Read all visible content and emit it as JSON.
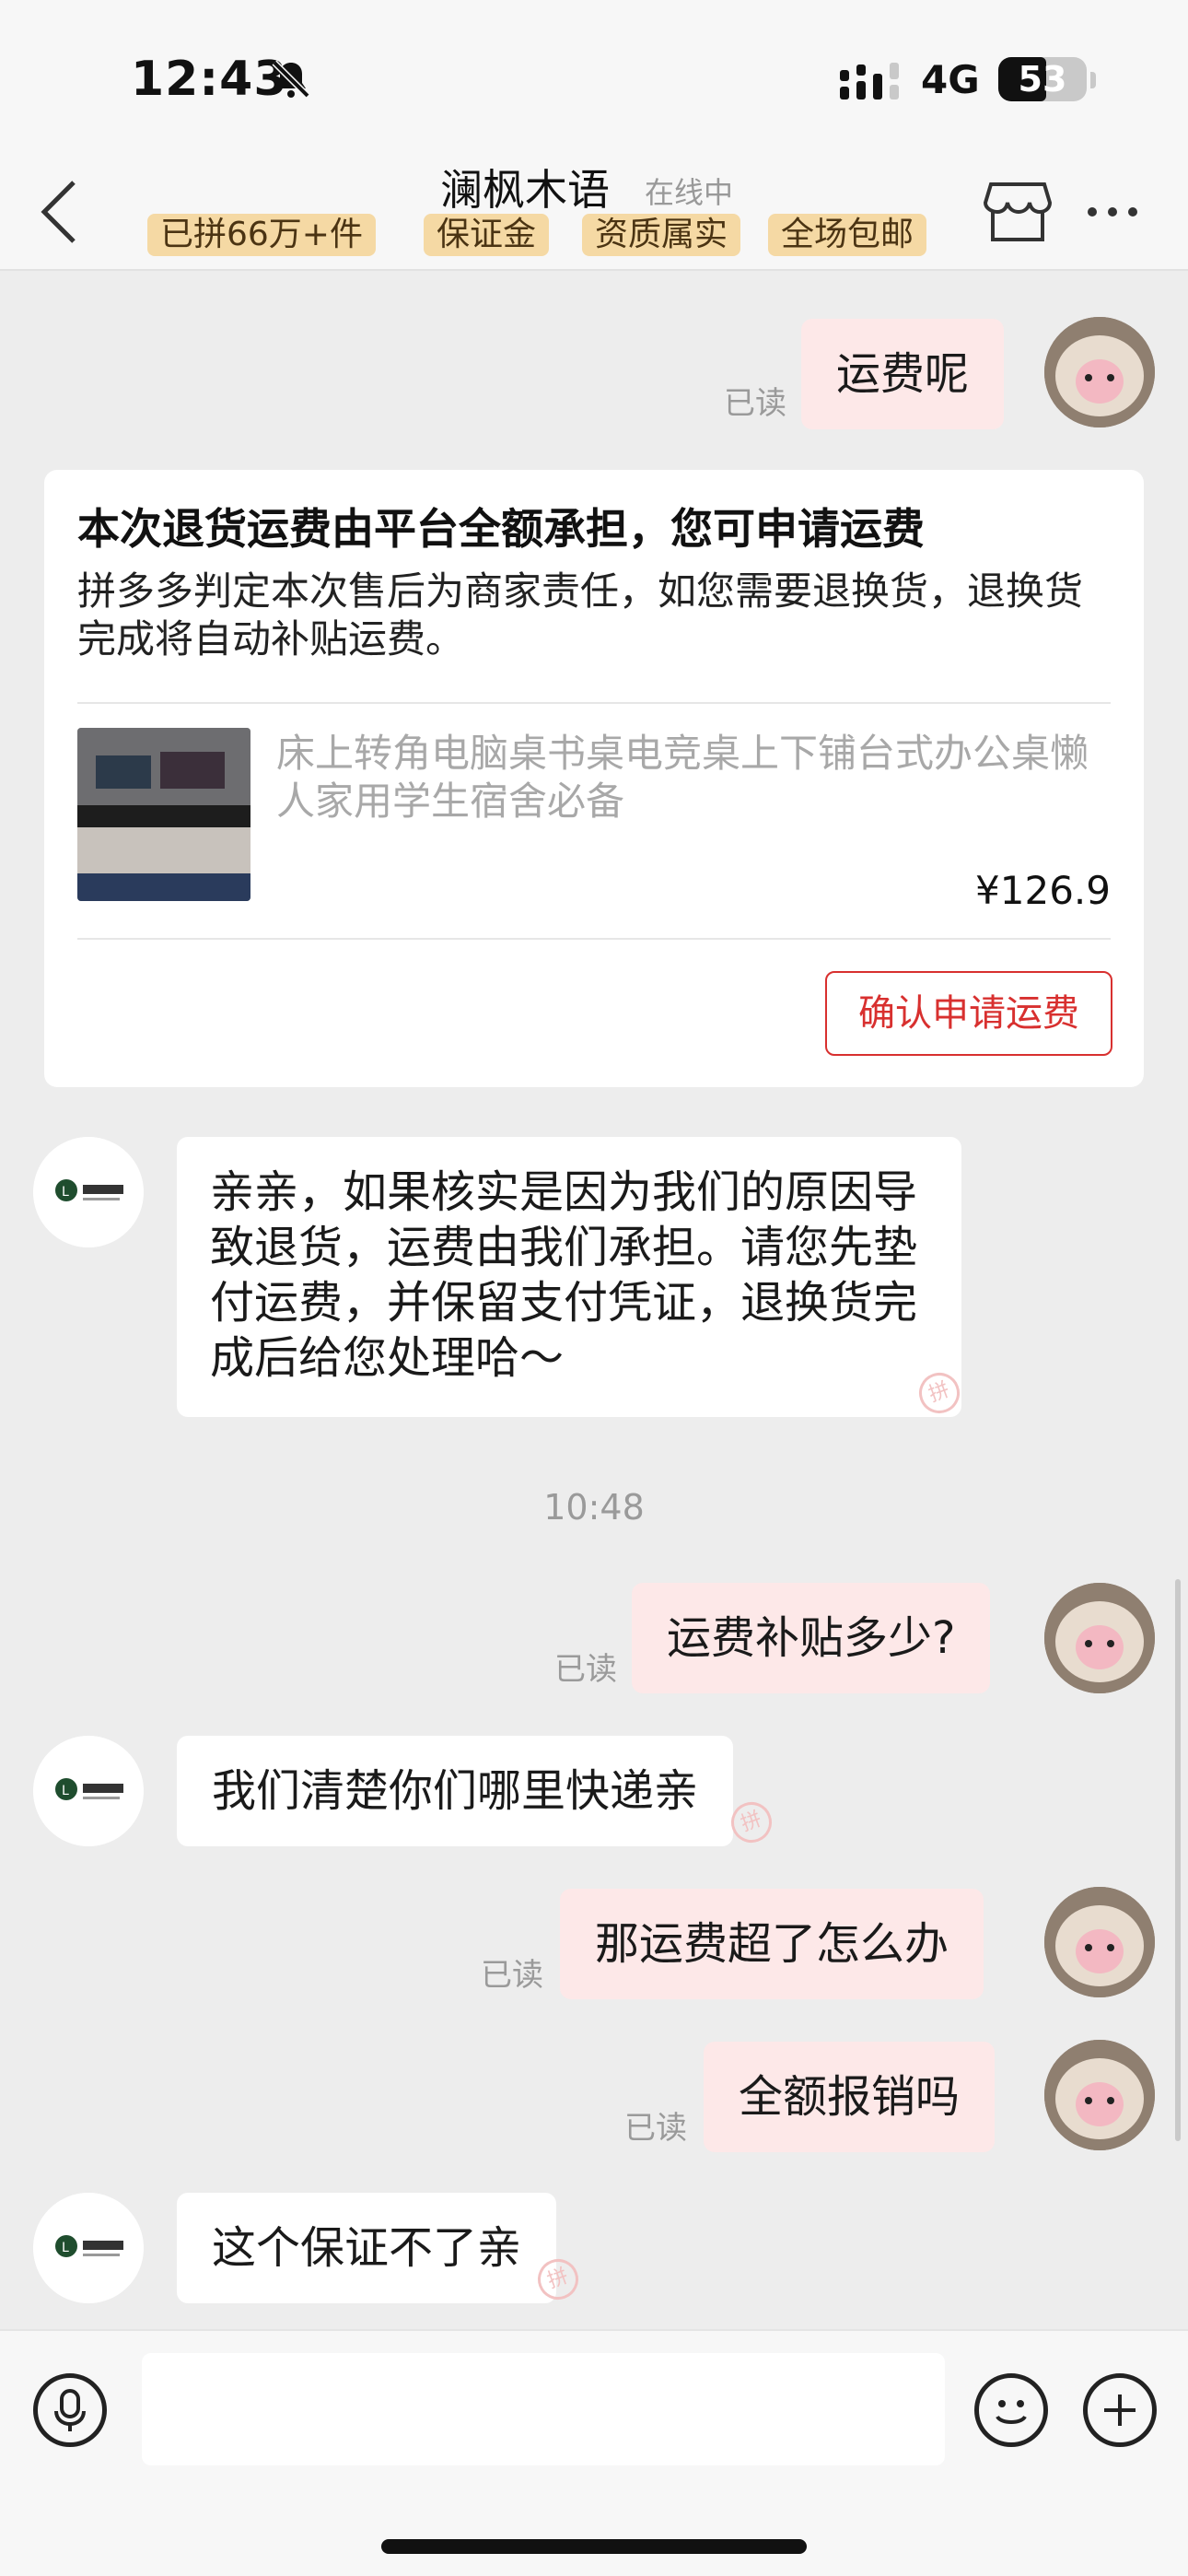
{
  "status_bar": {
    "time": "12:43",
    "network": "4G",
    "battery": "53"
  },
  "header": {
    "title": "澜枫木语",
    "status": "在线中",
    "badges": [
      "已拼66万+件",
      "保证金",
      "资质属实",
      "全场包邮"
    ]
  },
  "messages": [
    {
      "from": "me",
      "text": "运费呢",
      "read": "已读"
    },
    {
      "from": "system_card",
      "title": "本次退货运费由平台全额承担，您可申请运费",
      "description": "拼多多判定本次售后为商家责任，如您需要退换货，退换货完成将自动补贴运费。",
      "product_name": "床上转角电脑桌书桌电竞桌上下铺台式办公桌懒人家用学生宿舍必备",
      "price": "¥126.9",
      "button": "确认申请运费"
    },
    {
      "from": "shop",
      "text": "亲亲，如果核实是因为我们的原因导致退货，运费由我们承担。请您先垫付运费，并保留支付凭证，退换货完成后给您处理哈～"
    },
    {
      "from": "time",
      "text": "10:48"
    },
    {
      "from": "me",
      "text": "运费补贴多少?",
      "read": "已读"
    },
    {
      "from": "shop",
      "text": "我们清楚你们哪里快递亲"
    },
    {
      "from": "me",
      "text": "那运费超了怎么办",
      "read": "已读"
    },
    {
      "from": "me",
      "text": "全额报销吗",
      "read": "已读"
    },
    {
      "from": "shop",
      "text": "这个保证不了亲"
    }
  ],
  "shop_watermark": "拼",
  "input_bar": {
    "placeholder": ""
  },
  "colors": {
    "background": "#ededed",
    "my_bubble": "#fde8e8",
    "shop_bubble": "#ffffff",
    "badge": "#f5d9a4",
    "accent_red": "#d8302f"
  }
}
